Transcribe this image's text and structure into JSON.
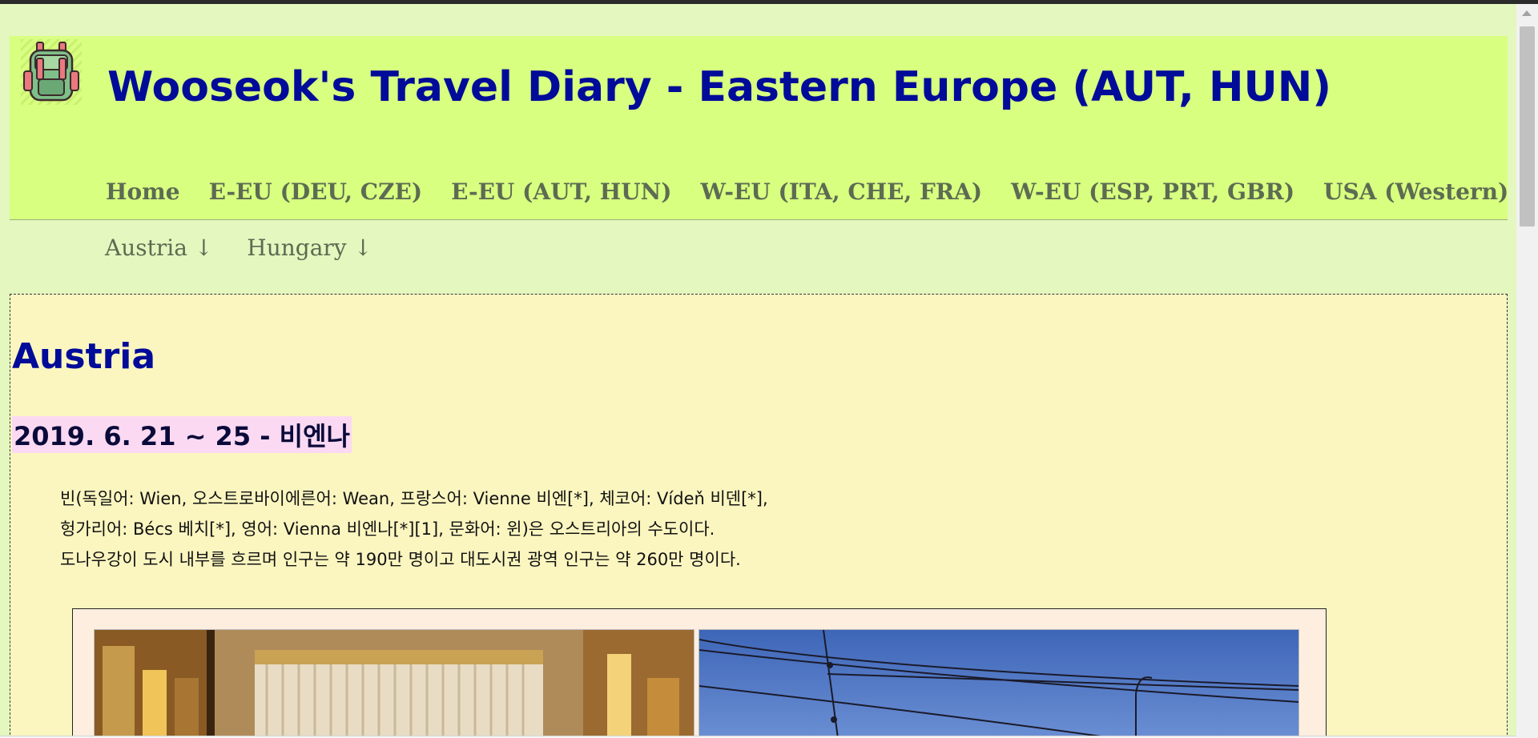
{
  "site": {
    "title": "Wooseok's Travel Diary - Eastern Europe (AUT, HUN)"
  },
  "nav": {
    "items": [
      {
        "label": "Home"
      },
      {
        "label": "E-EU (DEU, CZE)"
      },
      {
        "label": "E-EU (AUT, HUN)"
      },
      {
        "label": "W-EU (ITA, CHE, FRA)"
      },
      {
        "label": "W-EU (ESP, PRT, GBR)"
      },
      {
        "label": "USA (Western)"
      }
    ]
  },
  "subnav": {
    "items": [
      {
        "label": "Austria ↓"
      },
      {
        "label": "Hungary ↓"
      }
    ]
  },
  "content": {
    "heading": "Austria",
    "date_heading": "2019. 6. 21 ~ 25 - 비엔나",
    "paragraph_lines": [
      "빈(독일어: Wien, 오스트로바이에른어: Wean, 프랑스어: Vienne 비엔[*], 체코어: Vídeň 비덴[*],",
      "헝가리어: Bécs 베치[*], 영어: Vienna 비엔나[*][1], 문화어: 윈)은 오스트리아의 수도이다.",
      "도나우강이 도시 내부를 흐르며 인구는 약 190만 명이고 대도시권 광역 인구는 약 260만 명이다."
    ]
  },
  "colors": {
    "header_bg": "#d8ff80",
    "page_bg": "#e3f7bf",
    "content_bg": "#fbf6c0",
    "title_color": "#000b99",
    "nav_color": "#5d6b52",
    "date_highlight": "#fbd9f2",
    "gallery_bg": "#fdeedf"
  },
  "icons": {
    "logo": "backpack-icon"
  }
}
